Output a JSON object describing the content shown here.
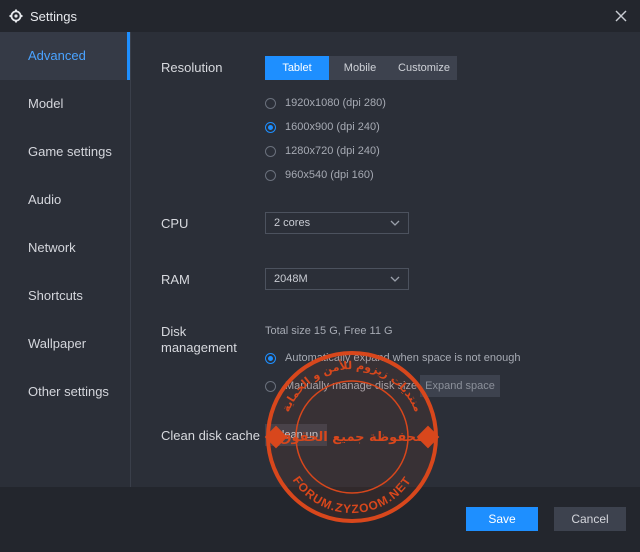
{
  "window": {
    "title": "Settings"
  },
  "sidebar": {
    "items": [
      {
        "label": "Advanced",
        "active": true
      },
      {
        "label": "Model"
      },
      {
        "label": "Game settings"
      },
      {
        "label": "Audio"
      },
      {
        "label": "Network"
      },
      {
        "label": "Shortcuts"
      },
      {
        "label": "Wallpaper"
      },
      {
        "label": "Other settings"
      }
    ]
  },
  "resolution": {
    "label": "Resolution",
    "tabs": [
      "Tablet",
      "Mobile",
      "Customize"
    ],
    "selected_tab": "Tablet",
    "options": [
      "1920x1080  (dpi 280)",
      "1600x900  (dpi 240)",
      "1280x720  (dpi 240)",
      "960x540  (dpi 160)"
    ],
    "selected_option": "1600x900  (dpi 240)"
  },
  "cpu": {
    "label": "CPU",
    "value": "2 cores"
  },
  "ram": {
    "label": "RAM",
    "value": "2048M"
  },
  "disk": {
    "label": "Disk management",
    "info": "Total size 15 G,  Free 11 G",
    "auto_option": "Automatically expand when space is not enough",
    "manual_option": "Manually manage disk size",
    "expand_button": "Expand space"
  },
  "cache": {
    "label": "Clean disk cache",
    "button": "Clean up"
  },
  "footer": {
    "save": "Save",
    "cancel": "Cancel"
  },
  "watermark": {
    "top_text": "منتديات زيزوم للأمن و الحماية",
    "middle_text": "محفوظة جميع الحقوق",
    "bottom_text": "FORUM.ZYZOOM.NET"
  },
  "colors": {
    "accent": "#1e8fff",
    "watermark": "#d8471c"
  }
}
